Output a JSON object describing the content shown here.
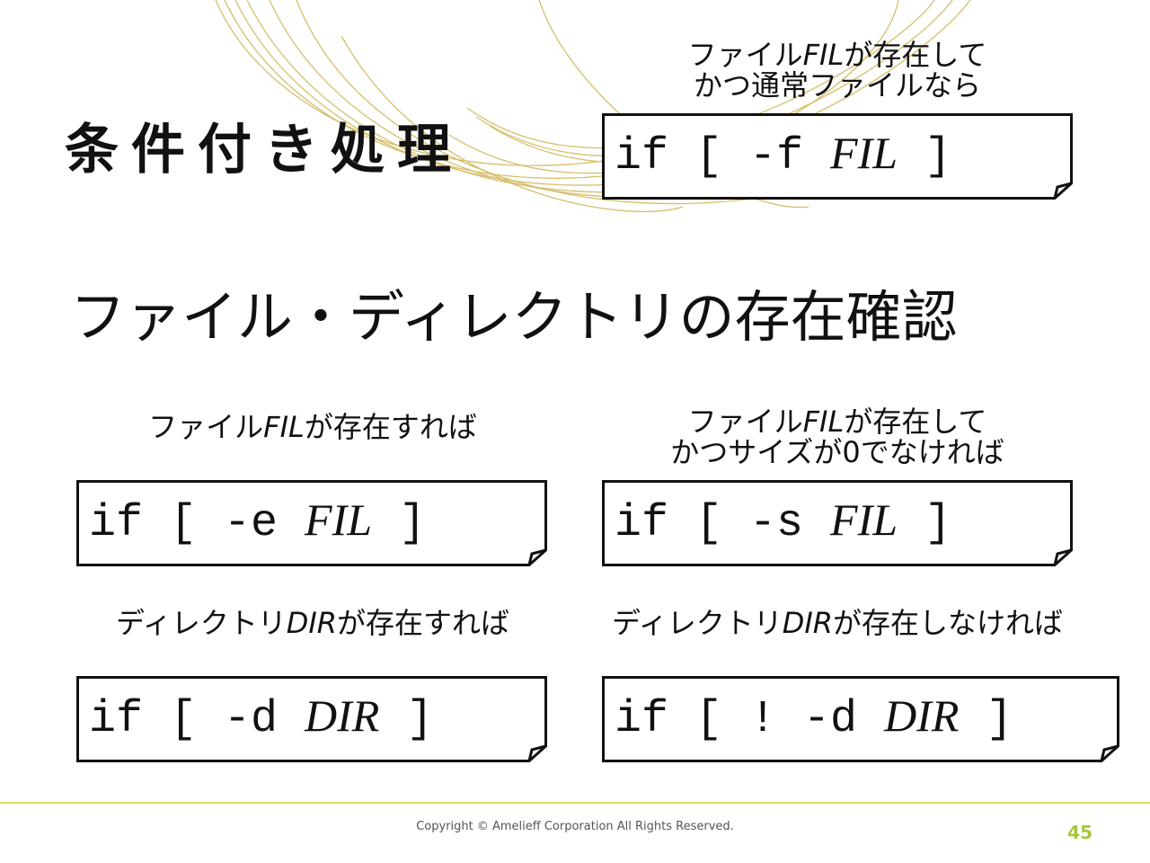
{
  "slide": {
    "title": "条件付き処理",
    "heading": "ファイル・ディレクトリの存在確認",
    "copyright": "Copyright © Amelieff Corporation All Rights Reserved.",
    "page_number": "45"
  },
  "colors": {
    "accent_line": "#d8e45a",
    "page_number": "#a6c63a",
    "swirl": "#c9a93a"
  },
  "examples": [
    {
      "caption_pre": "ファイル",
      "caption_em": "FIL",
      "caption_post": "が存在して",
      "caption_line2": "かつ通常ファイルなら",
      "code_prefix": "if [ -f ",
      "code_arg": "FIL",
      "code_suffix": " ]"
    },
    {
      "caption_pre": "ファイル",
      "caption_em": "FIL",
      "caption_post": "が存在すれば",
      "caption_line2": "",
      "code_prefix": "if [ -e ",
      "code_arg": "FIL",
      "code_suffix": " ]"
    },
    {
      "caption_pre": "ファイル",
      "caption_em": "FIL",
      "caption_post": "が存在して",
      "caption_line2": "かつサイズが0でなければ",
      "code_prefix": "if [ -s ",
      "code_arg": "FIL",
      "code_suffix": " ]"
    },
    {
      "caption_pre": "ディレクトリ",
      "caption_em": "DIR",
      "caption_post": "が存在すれば",
      "caption_line2": "",
      "code_prefix": "if [ -d ",
      "code_arg": "DIR",
      "code_suffix": " ]"
    },
    {
      "caption_pre": "ディレクトリ",
      "caption_em": "DIR",
      "caption_post": "が存在しなければ",
      "caption_line2": "",
      "code_prefix": "if [ ! -d ",
      "code_arg": "DIR",
      "code_suffix": " ]"
    }
  ]
}
